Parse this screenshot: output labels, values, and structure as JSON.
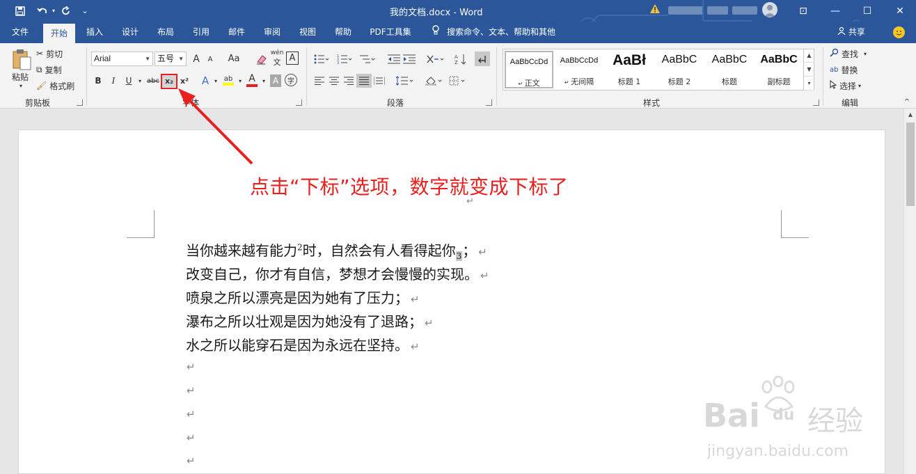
{
  "titlebar": {
    "doc_title": "我的文档.docx  -  Word",
    "save_icon": "save-icon",
    "undo_icon": "undo-icon",
    "redo_icon": "redo-icon",
    "qa_more": "⌄",
    "ribbon_display": "⊡",
    "minimize": "—",
    "maximize": "☐",
    "close": "✕"
  },
  "menu": {
    "tabs": [
      "文件",
      "开始",
      "插入",
      "设计",
      "布局",
      "引用",
      "邮件",
      "审阅",
      "视图",
      "帮助",
      "PDF工具集"
    ],
    "active_tab": "开始",
    "search_placeholder": "搜索命令、文本、帮助和其他",
    "share_label": "共享"
  },
  "ribbon": {
    "clipboard": {
      "label": "剪贴板",
      "paste": "粘贴",
      "cut": "剪切",
      "copy": "复制",
      "format_painter": "格式刷"
    },
    "font": {
      "label": "字体",
      "font_name": "Arial",
      "font_size": "五号",
      "grow": "A",
      "shrink": "A",
      "change_case": "Aa",
      "phonetic": "wén",
      "border_char": "A",
      "bold": "B",
      "italic": "I",
      "underline": "U",
      "strikethrough": "abc",
      "subscript": "x₂",
      "superscript": "x²",
      "text_effects": "A",
      "highlight": "ab",
      "font_color": "A",
      "char_shading": "A",
      "enclose": "字"
    },
    "paragraph": {
      "label": "段落"
    },
    "styles": {
      "label": "样式",
      "items": [
        {
          "preview": "AaBbCcDd",
          "name": "正文"
        },
        {
          "preview": "AaBbCcDd",
          "name": "无间隔"
        },
        {
          "preview": "AaBł",
          "name": "标题 1"
        },
        {
          "preview": "AaBbC",
          "name": "标题 2"
        },
        {
          "preview": "AaBbC",
          "name": "标题"
        },
        {
          "preview": "AaBbC",
          "name": "副标题"
        }
      ]
    },
    "editing": {
      "label": "编辑",
      "find": "查找",
      "replace": "替换",
      "select": "选择"
    }
  },
  "document": {
    "annotation": "点击“下标”选项，数字就变成下标了",
    "lines": [
      {
        "text": "当你越来越有能力",
        "sup": "2",
        "text2": "时，自然会有人看得起你",
        "sub": "3",
        "end": "；"
      },
      {
        "text": "改变自己，你才有自信，梦想才会慢慢的实现。"
      },
      {
        "text": "喷泉之所以漂亮是因为她有了压力；"
      },
      {
        "text": "瀑布之所以壮观是因为她没有了退路；"
      },
      {
        "text": "水之所以能穿石是因为永远在坚持。"
      }
    ],
    "paragraph_mark": "↵"
  },
  "watermark": {
    "brand": "Bai",
    "brand2": "du",
    "product": "经验",
    "url": "jingyan.baidu.com"
  }
}
